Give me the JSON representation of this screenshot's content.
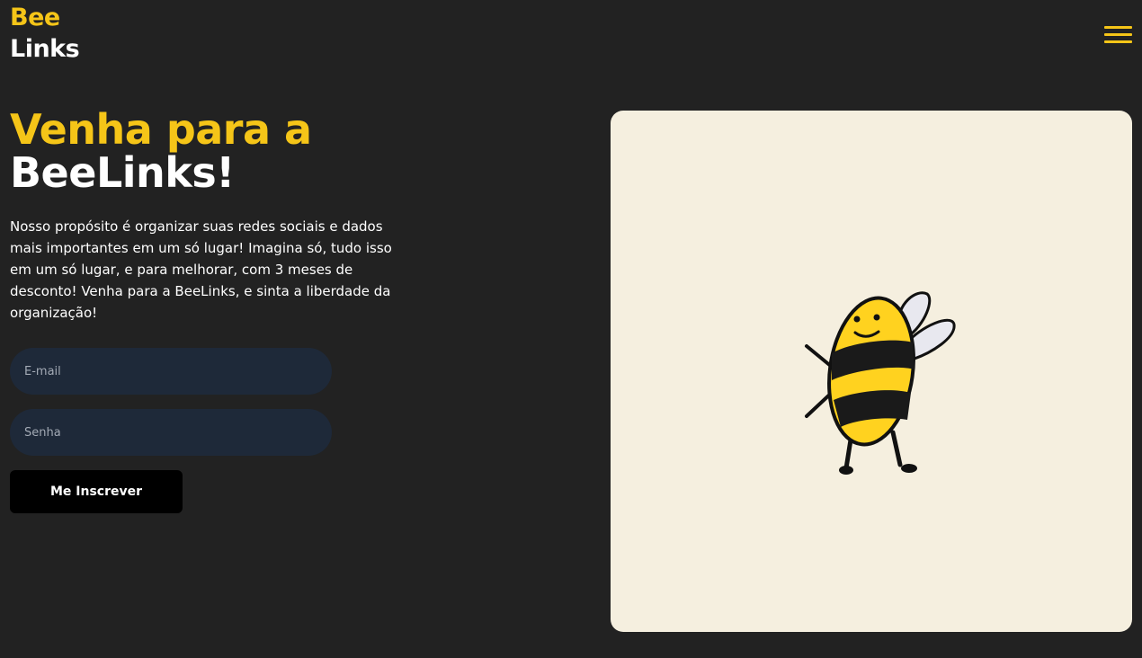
{
  "header": {
    "logo_line1": "Bee",
    "logo_line2": "Links",
    "menu_icon": "hamburger-menu-icon"
  },
  "hero": {
    "title_line1": "Venha para a",
    "title_line2": "BeeLinks!",
    "description": "Nosso propósito é organizar suas redes sociais e dados mais importantes em um só lugar! Imagina só, tudo isso em um só lugar, e para melhorar, com 3 meses de desconto! Venha para a BeeLinks, e sinta a liberdade da organização!"
  },
  "form": {
    "email_placeholder": "E-mail",
    "email_value": "",
    "password_placeholder": "Senha",
    "password_value": "",
    "submit_label": "Me Inscrever"
  },
  "illustration": {
    "subject": "bee-illustration"
  },
  "colors": {
    "background": "#222222",
    "accent": "#f5c518",
    "input_bg": "#1e2939",
    "illustration_bg": "#f5efdf"
  }
}
